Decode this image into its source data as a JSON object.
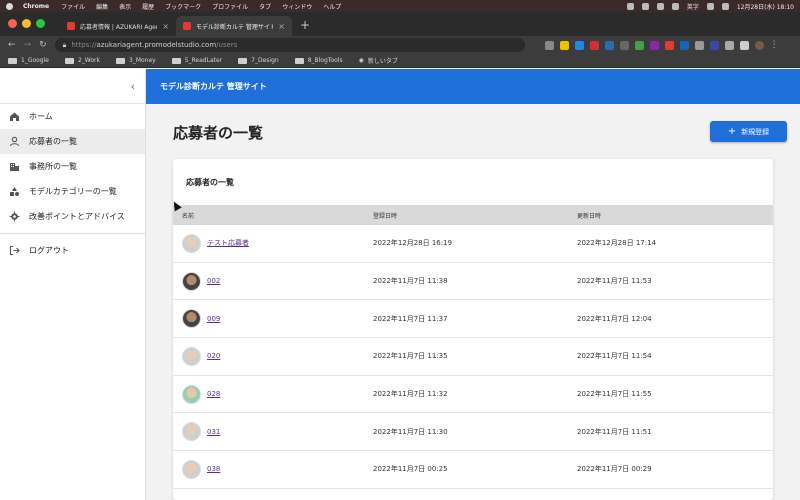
{
  "os_menubar": {
    "app": "Chrome",
    "items": [
      "ファイル",
      "編集",
      "表示",
      "履歴",
      "ブックマーク",
      "プロファイル",
      "タブ",
      "ウィンドウ",
      "ヘルプ"
    ],
    "input_mode": "英字",
    "clock": "12月28日(水) 18:10"
  },
  "browser": {
    "tabs": [
      {
        "title": "応募者情報 | AZUKARI Agent",
        "active": false
      },
      {
        "title": "モデル診断カルテ 管理サイト",
        "active": true
      }
    ],
    "url_prefix": "https://",
    "url_host": "azukariagent.promodelstudio.com",
    "url_path": "/users",
    "bookmarks": [
      "1_Google",
      "2_Work",
      "3_Money",
      "5_ReadLater",
      "7_Design",
      "8_BlogTools",
      "新しいタブ"
    ]
  },
  "app": {
    "title": "モデル診断カルテ 管理サイト",
    "brand_color": "#1e6fd9"
  },
  "sidebar": {
    "items": [
      {
        "label": "ホーム",
        "icon": "home-icon"
      },
      {
        "label": "応募者の一覧",
        "icon": "person-icon",
        "active": true
      },
      {
        "label": "事務所の一覧",
        "icon": "building-icon"
      },
      {
        "label": "モデルカテゴリーの一覧",
        "icon": "category-icon"
      },
      {
        "label": "改善ポイントとアドバイス",
        "icon": "gear-icon"
      }
    ],
    "logout_label": "ログアウト"
  },
  "main": {
    "page_title": "応募者の一覧",
    "new_button_label": "新規登録",
    "card_title": "応募者の一覧",
    "columns": [
      "名前",
      "登録日時",
      "更新日時"
    ],
    "rows": [
      {
        "name": "テスト応募者",
        "registered": "2022年12月28日 16:19",
        "updated": "2022年12月28日 17:14"
      },
      {
        "name": "002",
        "registered": "2022年11月7日 11:38",
        "updated": "2022年11月7日 11:53"
      },
      {
        "name": "009",
        "registered": "2022年11月7日 11:37",
        "updated": "2022年11月7日 12:04"
      },
      {
        "name": "020",
        "registered": "2022年11月7日 11:35",
        "updated": "2022年11月7日 11:54"
      },
      {
        "name": "028",
        "registered": "2022年11月7日 11:32",
        "updated": "2022年11月7日 11:55"
      },
      {
        "name": "031",
        "registered": "2022年11月7日 11:30",
        "updated": "2022年11月7日 11:51"
      },
      {
        "name": "038",
        "registered": "2022年11月7日 00:25",
        "updated": "2022年11月7日 00:29"
      }
    ]
  }
}
